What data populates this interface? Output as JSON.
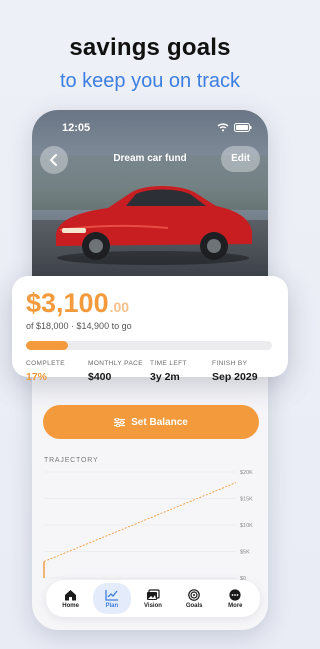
{
  "promo": {
    "title": "savings goals",
    "subtitle": "to keep you on track"
  },
  "status_bar": {
    "time": "12:05"
  },
  "header": {
    "title": "Dream car fund",
    "edit_label": "Edit"
  },
  "summary": {
    "amount": "$3,100",
    "cents": ".00",
    "of_line": "of $18,000 · $14,900 to go",
    "progress_fraction": 0.17,
    "stats": [
      {
        "label": "COMPLETE",
        "value": "17%"
      },
      {
        "label": "MONTHLY PACE",
        "value": "$400"
      },
      {
        "label": "TIME LEFT",
        "value": "3y 2m"
      },
      {
        "label": "FINISH BY",
        "value": "Sep 2029"
      }
    ]
  },
  "actions": {
    "set_balance_label": "Set Balance"
  },
  "trajectory": {
    "label": "TRAJECTORY",
    "chart_data": {
      "type": "line",
      "ylim": [
        0,
        20000
      ],
      "yticks": [
        "$0",
        "$5K",
        "$10K",
        "$15K",
        "$20K"
      ],
      "series": [
        {
          "x": [
            0,
            1
          ],
          "values": [
            3100,
            18000
          ]
        }
      ]
    }
  },
  "tabs": [
    {
      "label": "Home",
      "icon": "home-icon"
    },
    {
      "label": "Plan",
      "icon": "chart-line-icon"
    },
    {
      "label": "Vision",
      "icon": "images-icon"
    },
    {
      "label": "Goals",
      "icon": "target-icon"
    },
    {
      "label": "More",
      "icon": "ellipsis-icon"
    }
  ],
  "colors": {
    "accent": "#f39a3c",
    "brand_blue": "#3d7fe0"
  }
}
